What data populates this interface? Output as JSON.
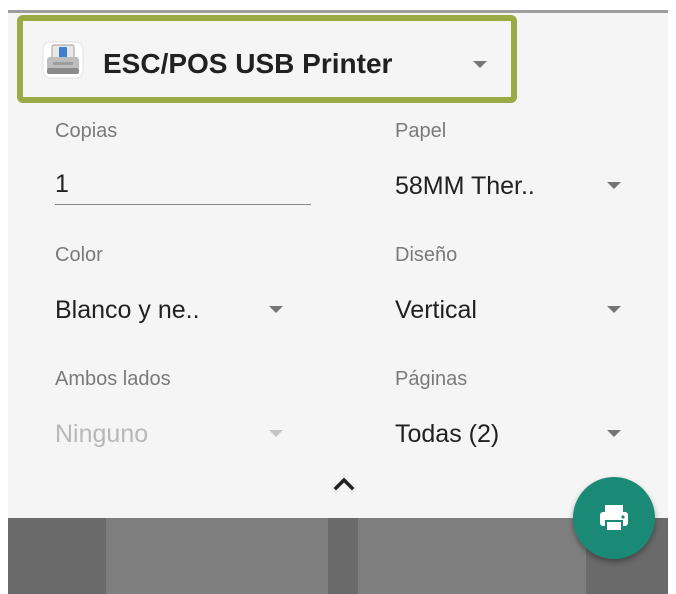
{
  "printer": {
    "name": "ESC/POS USB Printer",
    "icon": "usb-printer-icon"
  },
  "options": {
    "copies": {
      "label": "Copias",
      "value": "1"
    },
    "paper": {
      "label": "Papel",
      "value": "58MM Ther.."
    },
    "color": {
      "label": "Color",
      "value": "Blanco y ne.."
    },
    "layout": {
      "label": "Diseño",
      "value": "Vertical"
    },
    "duplex": {
      "label": "Ambos lados",
      "value": "Ninguno"
    },
    "pages": {
      "label": "Páginas",
      "value": "Todas (2)"
    }
  },
  "colors": {
    "highlight_border": "#9aaa45",
    "fab": "#1a8a76"
  }
}
